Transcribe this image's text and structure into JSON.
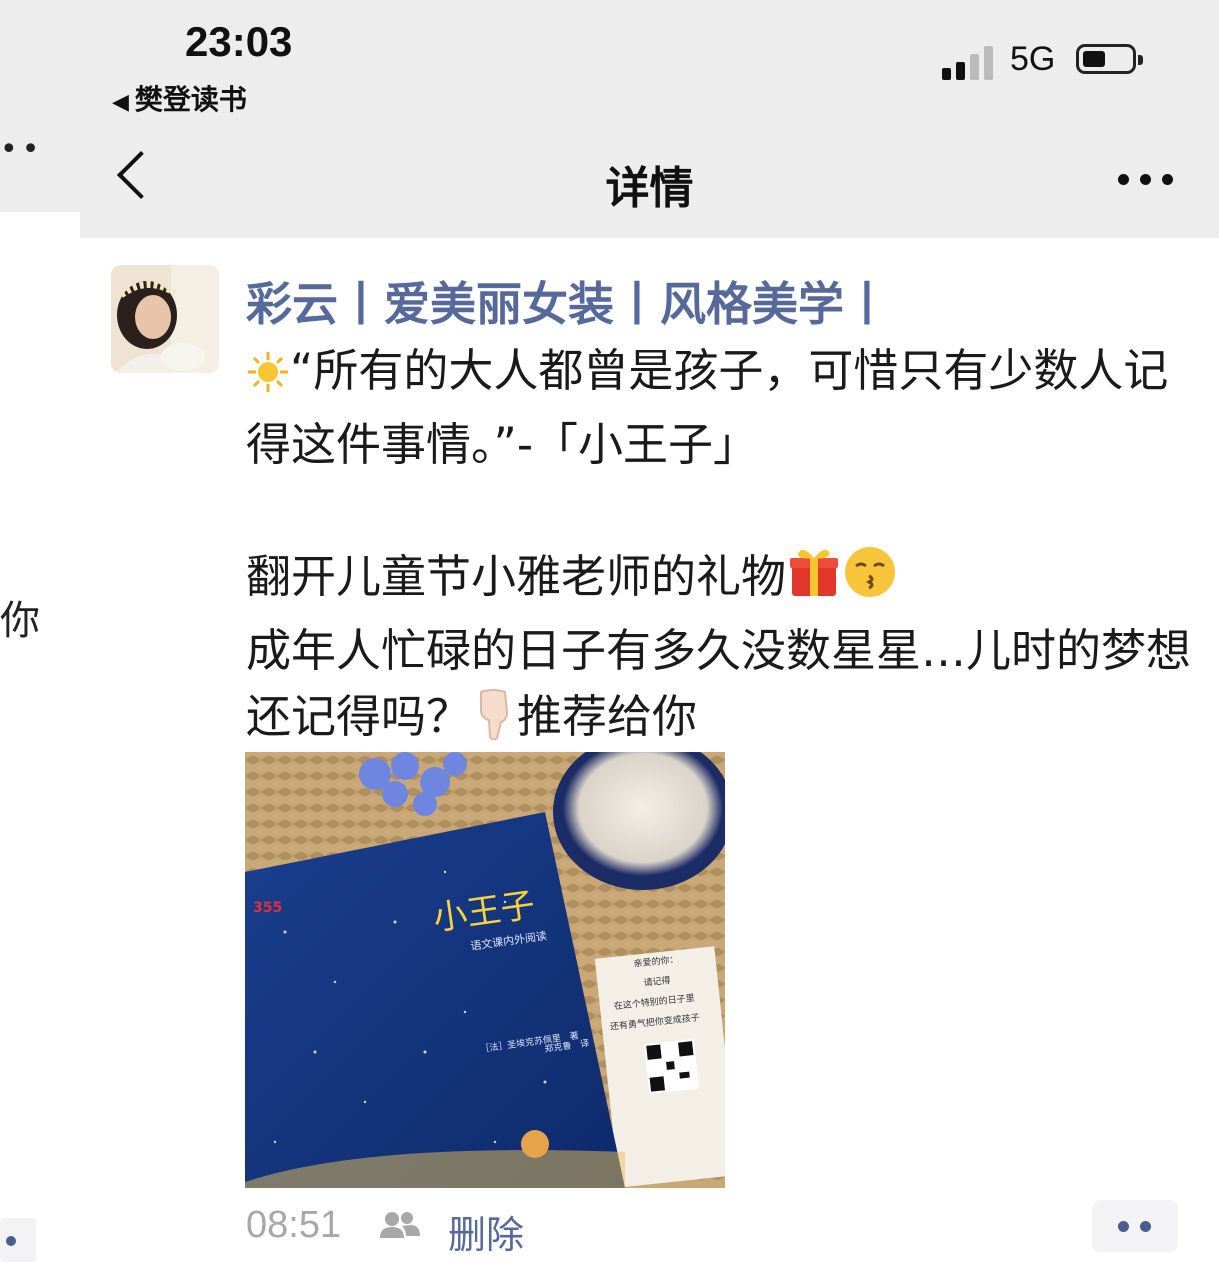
{
  "status_bar": {
    "time": "23:03",
    "back_app": "樊登读书",
    "network": "5G",
    "back_glyph": "◀"
  },
  "navbar": {
    "title": "详情"
  },
  "peek": {
    "char": "你"
  },
  "post": {
    "author": "彩云丨爱美丽女装丨风格美学丨",
    "text_line1": "“所有的大人都曾是孩子，可惜只有少数人记得这件事情。”-「小王子」",
    "text_line2": "翻开儿童节小雅老师的礼物",
    "text_line3": "成年人忙碌的日子有多久没数星星…儿时的梦想还记得吗？",
    "text_line3_tail": "推荐给你",
    "time": "08:51",
    "delete_label": "删除"
  },
  "photo": {
    "book_title": "小王子",
    "book_subtitle": "语文课内外阅读",
    "book_author": "［法］圣埃克苏佩里　著",
    "book_translator": "郑克鲁　译",
    "card_lines": [
      "亲爱的你：",
      "请记得",
      "在这个特别的日子里",
      "还有勇气把你变成孩子"
    ]
  },
  "icons": [
    "sun-emoji-icon",
    "gift-emoji-icon",
    "kiss-emoji-icon",
    "pointing-down-emoji-icon",
    "friends-icon",
    "more-icon",
    "back-chevron-icon"
  ]
}
